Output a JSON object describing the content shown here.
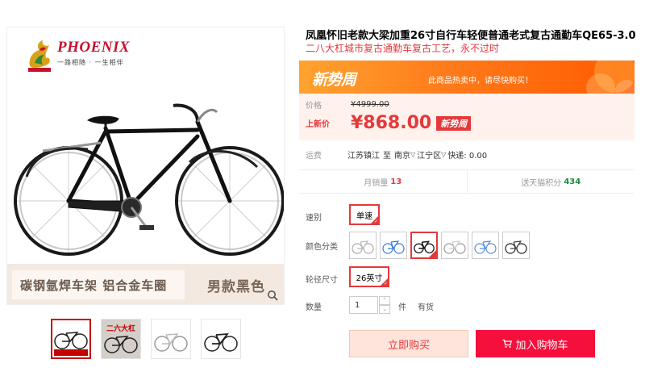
{
  "gallery": {
    "brand_name": "PHOENIX",
    "brand_slogan": "一路相随 · 一生相伴",
    "feature_left": "碳钢氩焊车架  铝合金车圈",
    "feature_right": "男款黑色",
    "thumbnails": [
      {
        "label": "",
        "selected": true
      },
      {
        "label": "二六大杠",
        "selected": false
      },
      {
        "label": "",
        "selected": false
      },
      {
        "label": "",
        "selected": false
      }
    ]
  },
  "product": {
    "title": "凤凰怀旧老款大梁加重26寸自行车轻便普通老式复古通勤车QE65-3.0",
    "subtitle": "二八大杠城市复古通勤车复古工艺，永不过时"
  },
  "promo": {
    "title": "新势周",
    "note": "此商品热卖中，请尽快购买！"
  },
  "price": {
    "orig_label": "价格",
    "orig_value": "¥4999.00",
    "new_label": "上新价",
    "new_value": "¥868.00",
    "tag": "新势周"
  },
  "shipping": {
    "label": "运费",
    "from": "江苏镇江",
    "to_word": "至",
    "city": "南京",
    "district": "江宁区",
    "fee": "快递: 0.00"
  },
  "stats": {
    "monthly_sales_label": "月销量",
    "monthly_sales_value": "13",
    "points_label": "送天猫积分",
    "points_value": "434"
  },
  "options": {
    "speed_label": "速别",
    "speed_value": "单速",
    "color_label": "颜色分类",
    "size_label": "轮径尺寸",
    "size_value": "26英寸",
    "qty_label": "数量",
    "qty_value": "1",
    "unit": "件",
    "stock": "有货"
  },
  "actions": {
    "buy_now": "立即购买",
    "add_to_cart": "加入购物车"
  },
  "colors": {
    "accent": "#e4393c",
    "promo_orange": "#ff7a1a",
    "cart_red": "#f40f3c"
  }
}
